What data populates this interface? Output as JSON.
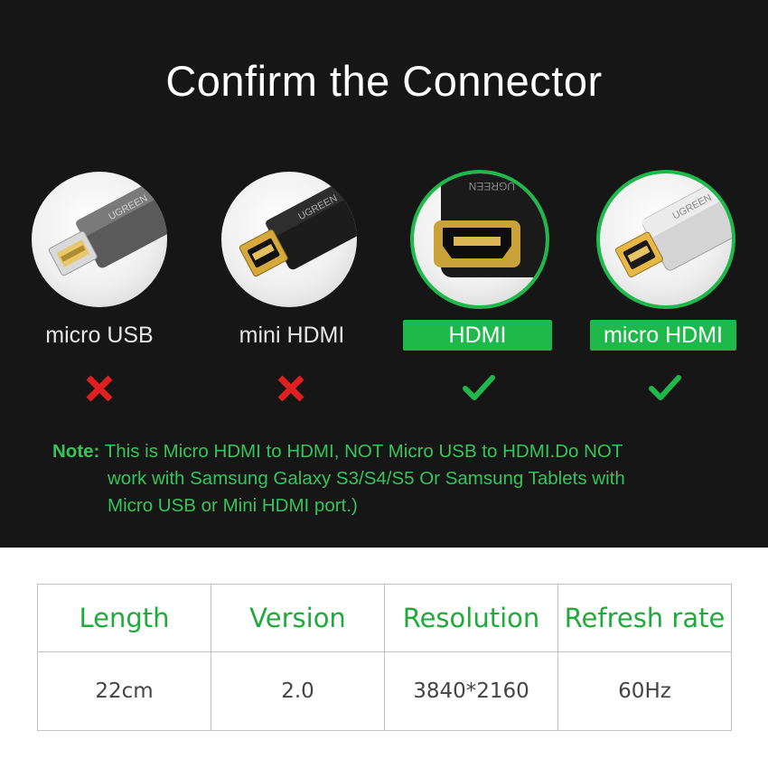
{
  "title": "Confirm the Connector",
  "connectors": [
    {
      "label": "micro USB",
      "status": "incompatible",
      "brand": "UGREEN",
      "mark_icon": "x-mark-icon"
    },
    {
      "label": "mini HDMI",
      "status": "incompatible",
      "brand": "UGREEN",
      "mark_icon": "x-mark-icon"
    },
    {
      "label": "HDMI",
      "status": "compatible",
      "brand": "UGREEN",
      "mark_icon": "checkmark-icon"
    },
    {
      "label": "micro HDMI",
      "status": "compatible",
      "brand": "UGREEN",
      "mark_icon": "checkmark-icon"
    }
  ],
  "note": {
    "label": "Note:",
    "lines": [
      "This is Micro HDMI to HDMI, NOT Micro USB to HDMI.Do NOT",
      "work with Samsung Galaxy S3/S4/S5 Or Samsung Tablets with",
      "Micro USB or Mini HDMI port.)"
    ]
  },
  "specs": {
    "headers": [
      "Length",
      "Version",
      "Resolution",
      "Refresh rate"
    ],
    "values": [
      "22cm",
      "2.0",
      "3840*2160",
      "60Hz"
    ]
  },
  "colors": {
    "background_top": "#161616",
    "accent_green": "#1fb84a",
    "note_green": "#36c45a",
    "x_red": "#e02020",
    "header_green": "#1faa3c"
  }
}
